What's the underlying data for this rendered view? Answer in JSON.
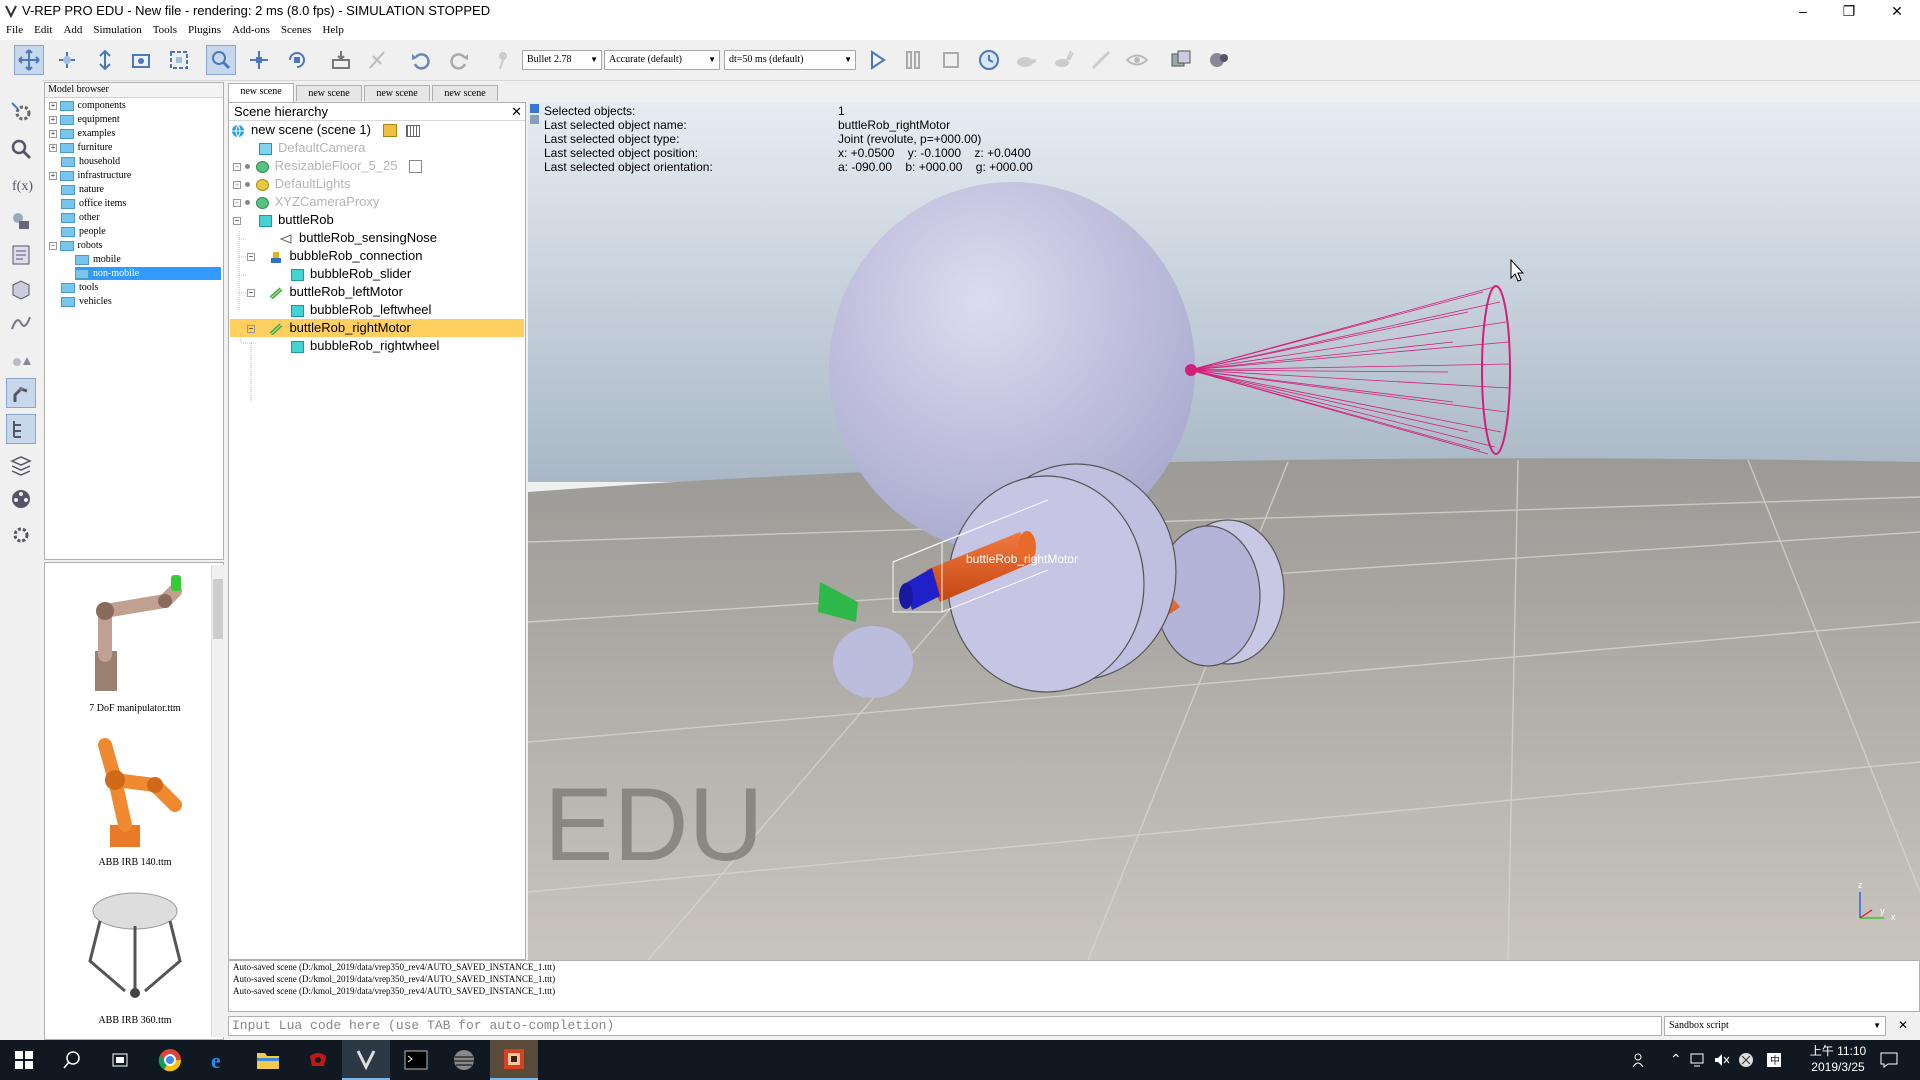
{
  "window": {
    "title": "V-REP PRO EDU - New file - rendering: 2 ms (8.0 fps) - SIMULATION STOPPED",
    "minimize": "–",
    "restore": "❐",
    "close": "✕"
  },
  "menu": [
    "File",
    "Edit",
    "Add",
    "Simulation",
    "Tools",
    "Plugins",
    "Add-ons",
    "Scenes",
    "Help"
  ],
  "toolbar": {
    "engine": "Bullet 2.78",
    "accuracy": "Accurate (default)",
    "timestep": "dt=50 ms (default)"
  },
  "model_browser": {
    "header": "Model browser",
    "items": [
      {
        "label": "components",
        "expand": "+"
      },
      {
        "label": "equipment",
        "expand": "+"
      },
      {
        "label": "examples",
        "expand": "+"
      },
      {
        "label": "furniture",
        "expand": "+"
      },
      {
        "label": "household",
        "expand": ""
      },
      {
        "label": "infrastructure",
        "expand": "+"
      },
      {
        "label": "nature",
        "expand": ""
      },
      {
        "label": "office items",
        "expand": ""
      },
      {
        "label": "other",
        "expand": ""
      },
      {
        "label": "people",
        "expand": ""
      },
      {
        "label": "robots",
        "expand": "−"
      },
      {
        "label": "mobile",
        "expand": ""
      },
      {
        "label": "non-mobile",
        "expand": ""
      },
      {
        "label": "tools",
        "expand": ""
      },
      {
        "label": "vehicles",
        "expand": ""
      }
    ],
    "thumbnails": [
      "7 DoF manipulator.ttm",
      "ABB IRB 140.ttm",
      "ABB IRB 360.ttm"
    ]
  },
  "scene_tabs": [
    "new scene",
    "new scene",
    "new scene",
    "new scene"
  ],
  "hierarchy": {
    "header": "Scene hierarchy",
    "rows": [
      {
        "label": "new scene (scene 1)"
      },
      {
        "label": "DefaultCamera"
      },
      {
        "label": "ResizableFloor_5_25"
      },
      {
        "label": "DefaultLights"
      },
      {
        "label": "XYZCameraProxy"
      },
      {
        "label": "buttleRob"
      },
      {
        "label": "buttleRob_sensingNose"
      },
      {
        "label": "bubbleRob_connection"
      },
      {
        "label": "bubbleRob_slider"
      },
      {
        "label": "buttleRob_leftMotor"
      },
      {
        "label": "bubbleRob_leftwheel"
      },
      {
        "label": "buttleRob_rightMotor"
      },
      {
        "label": "bubbleRob_rightwheel"
      }
    ]
  },
  "selection_info": {
    "labels": [
      "Selected objects:",
      "Last selected object name:",
      "Last selected object type:",
      "Last selected object position:",
      "Last selected object orientation:"
    ],
    "values": [
      "1",
      "buttleRob_rightMotor",
      "Joint (revolute, p=+000.00)",
      "x: +0.0500    y: -0.1000    z: +0.0400",
      "a: -090.00    b: +000.00    g: +000.00"
    ]
  },
  "viewport": {
    "object_label": "buttleRob_rightMotor",
    "watermark": "EDU",
    "axis_z": "z",
    "axis_y": "y",
    "axis_x": "x"
  },
  "console": [
    "Auto-saved scene (D:/kmol_2019/data/vrep350_rev4/AUTO_SAVED_INSTANCE_1.ttt)",
    "Auto-saved scene (D:/kmol_2019/data/vrep350_rev4/AUTO_SAVED_INSTANCE_1.ttt)",
    "Auto-saved scene (D:/kmol_2019/data/vrep350_rev4/AUTO_SAVED_INSTANCE_1.ttt)"
  ],
  "lua_input": {
    "placeholder": "Input Lua code here (use TAB for auto-completion)"
  },
  "script_select": "Sandbox script",
  "taskbar": {
    "time": "上午 11:10",
    "date": "2019/3/25"
  },
  "colors": {
    "selection": "#ffd060",
    "sphere": "#c4c4e0",
    "motor": "#e85a1e",
    "sensor_cone": "#d0207a",
    "floor": "#bdb8b0"
  }
}
